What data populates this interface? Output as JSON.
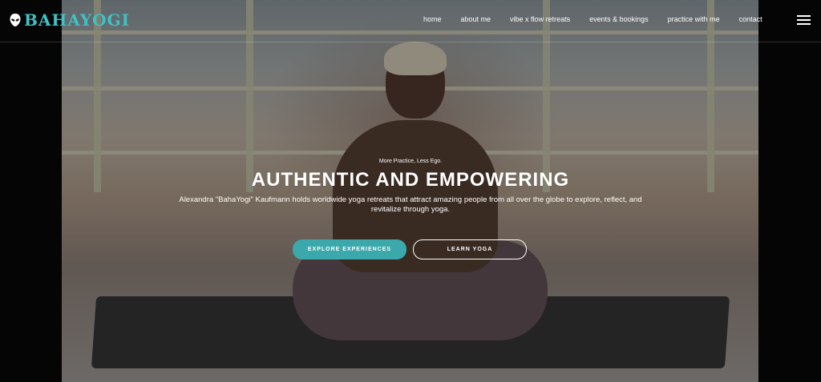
{
  "brand": {
    "name": "BAHAYOGI",
    "color": "#3fc1c5",
    "icon": "alien-head-icon"
  },
  "nav": {
    "items": [
      "home",
      "about me",
      "vibe x flow retreats",
      "events & bookings",
      "practice with me",
      "contact"
    ],
    "menu_icon": "hamburger-menu-icon"
  },
  "hero": {
    "tagline": "More Practice, Less Ego.",
    "headline": "AUTHENTIC AND EMPOWERING",
    "description": "Alexandra \"BahaYogi\" Kaufmann holds worldwide yoga retreats that attract amazing people from all over the globe to explore, reflect, and revitalize through yoga.",
    "primary_button": "EXPLORE EXPERIENCES",
    "secondary_button": "LEARN YOGA",
    "accent_color": "#3ba9ac"
  }
}
